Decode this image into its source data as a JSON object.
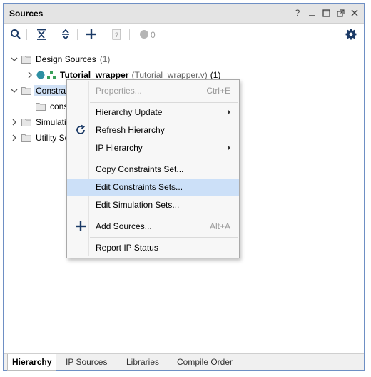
{
  "window": {
    "title": "Sources"
  },
  "toolbar": {
    "count": "0"
  },
  "tree": {
    "design_sources": {
      "label": "Design Sources",
      "count": "(1)"
    },
    "wrapper": {
      "name": "Tutorial_wrapper",
      "file": "(Tutorial_wrapper.v)",
      "count": "(1)"
    },
    "constraints": {
      "label": "Constrai"
    },
    "constrs_child": {
      "label": "cons"
    },
    "simulation": {
      "label": "Simulatio"
    },
    "utility": {
      "label": "Utility So"
    }
  },
  "context_menu": {
    "items": [
      {
        "label": "Properties...",
        "shortcut": "Ctrl+E"
      },
      {
        "label": "Hierarchy Update"
      },
      {
        "label": "Refresh Hierarchy"
      },
      {
        "label": "IP Hierarchy"
      },
      {
        "label": "Copy Constraints Set..."
      },
      {
        "label": "Edit Constraints Sets..."
      },
      {
        "label": "Edit Simulation Sets..."
      },
      {
        "label": "Add Sources...",
        "shortcut": "Alt+A"
      },
      {
        "label": "Report IP Status"
      }
    ]
  },
  "tabs": [
    "Hierarchy",
    "IP Sources",
    "Libraries",
    "Compile Order"
  ],
  "colors": {
    "accent": "#2e75b6",
    "selection": "#cce0f8",
    "panel_border": "#6e8fc4"
  }
}
